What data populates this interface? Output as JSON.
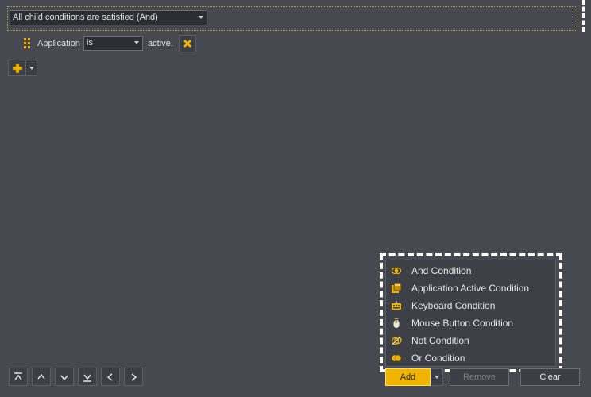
{
  "root_condition": {
    "selected": "All child conditions are satisfied (And)"
  },
  "child_condition": {
    "type_label": "Application",
    "operator": "is",
    "suffix": "active."
  },
  "popup_menu": {
    "items": [
      {
        "label": "And Condition",
        "icon": "and-condition-icon"
      },
      {
        "label": "Application Active Condition",
        "icon": "application-icon"
      },
      {
        "label": "Keyboard Condition",
        "icon": "keyboard-icon"
      },
      {
        "label": "Mouse Button Condition",
        "icon": "mouse-icon"
      },
      {
        "label": "Not Condition",
        "icon": "not-condition-icon"
      },
      {
        "label": "Or Condition",
        "icon": "or-condition-icon"
      }
    ]
  },
  "footer": {
    "add_label": "Add",
    "remove_label": "Remove",
    "clear_label": "Clear"
  },
  "colors": {
    "accent": "#f0b400",
    "background": "#464a50"
  }
}
